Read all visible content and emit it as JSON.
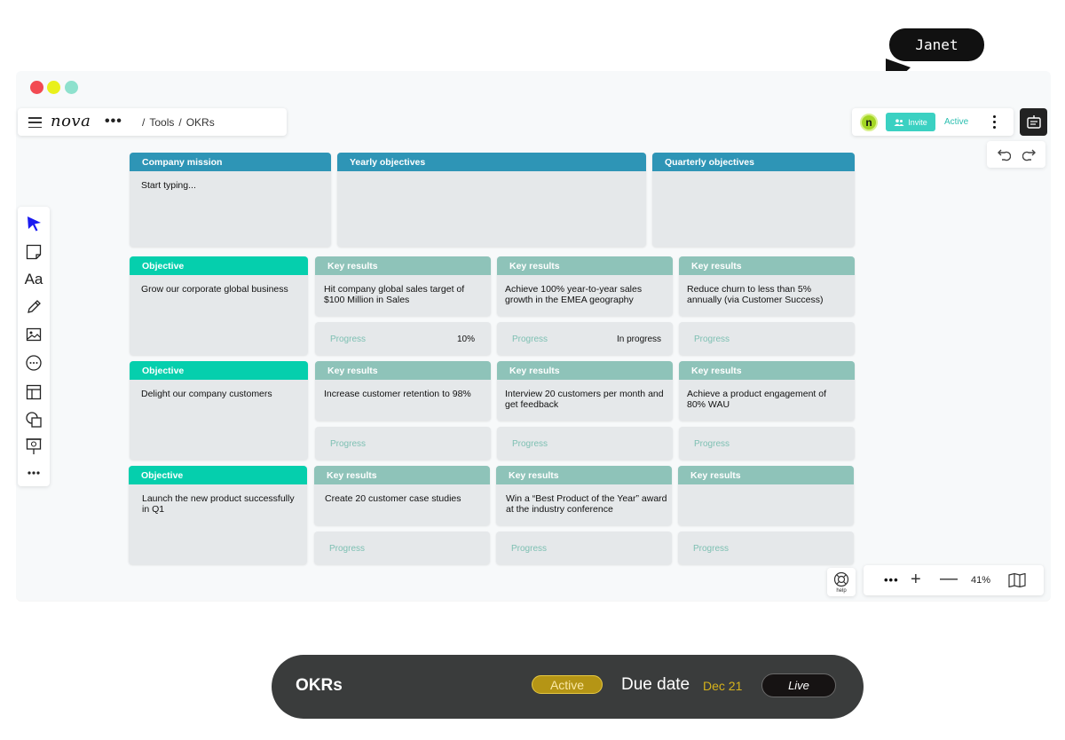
{
  "app": {
    "logo": "nova"
  },
  "breadcrumb": {
    "more": "•••",
    "sep1": "/",
    "tools": "Tools",
    "sep2": "/",
    "current": "OKRs"
  },
  "collab": {
    "avatar_letter": "n",
    "invite_label": "Invite",
    "status_label": "Active",
    "cursor_user": "Janet"
  },
  "board": {
    "mission": {
      "header": "Company mission",
      "text": "Start typing..."
    },
    "yearly": {
      "header": "Yearly objectives",
      "text": ""
    },
    "quarterly": {
      "header": "Quarterly objectives",
      "text": ""
    },
    "rows": [
      {
        "objective": {
          "header": "Objective",
          "text": "Grow our corporate global business"
        },
        "key_results": [
          {
            "header": "Key results",
            "text": "Hit company global sales target of $100 Million in Sales",
            "progress_label": "Progress",
            "progress_value": "10%"
          },
          {
            "header": "Key results",
            "text": "Achieve 100% year-to-year sales growth in the EMEA geography",
            "progress_label": "Progress",
            "progress_value": "In progress"
          },
          {
            "header": "Key results",
            "text": "Reduce churn to less than 5% annually (via Customer Success)",
            "progress_label": "Progress",
            "progress_value": ""
          }
        ]
      },
      {
        "objective": {
          "header": "Objective",
          "text": "Delight our company customers"
        },
        "key_results": [
          {
            "header": "Key results",
            "text": "Increase customer retention to 98%",
            "progress_label": "Progress",
            "progress_value": ""
          },
          {
            "header": "Key results",
            "text": "Interview 20 customers per month and get feedback",
            "progress_label": "Progress",
            "progress_value": ""
          },
          {
            "header": "Key results",
            "text": "Achieve a product engagement of 80% WAU",
            "progress_label": "Progress",
            "progress_value": ""
          }
        ]
      },
      {
        "objective": {
          "header": "Objective",
          "text": "Launch the new product successfully in Q1"
        },
        "key_results": [
          {
            "header": "Key results",
            "text": "Create 20 customer case studies",
            "progress_label": "Progress",
            "progress_value": ""
          },
          {
            "header": "Key results",
            "text": "Win a “Best Product of the Year” award at the industry conference",
            "progress_label": "Progress",
            "progress_value": ""
          },
          {
            "header": "Key results",
            "text": "",
            "progress_label": "Progress",
            "progress_value": ""
          }
        ]
      }
    ]
  },
  "help": {
    "label": "help"
  },
  "zoom": {
    "more": "•••",
    "plus": "+",
    "minus": "—",
    "level": "41%"
  },
  "status_bar": {
    "title": "OKRs",
    "badge": "Active",
    "due_label": "Due date",
    "due_value": "Dec 21",
    "live_label": "Live"
  },
  "colors": {
    "mission_header": "#2e95b6",
    "objective_header": "#05cfad",
    "key_results_header": "#8ec3b9",
    "card_bg": "#e5e8ea",
    "invite": "#3bd1c2",
    "badge": "#b59515"
  },
  "icons": [
    "menu-icon",
    "select-arrow-icon",
    "sticky-note-icon",
    "text-icon",
    "pen-icon",
    "image-icon",
    "comment-icon",
    "template-icon",
    "shapes-icon",
    "presentation-icon",
    "undo-icon",
    "redo-icon",
    "board-icon",
    "help-icon",
    "map-icon"
  ]
}
